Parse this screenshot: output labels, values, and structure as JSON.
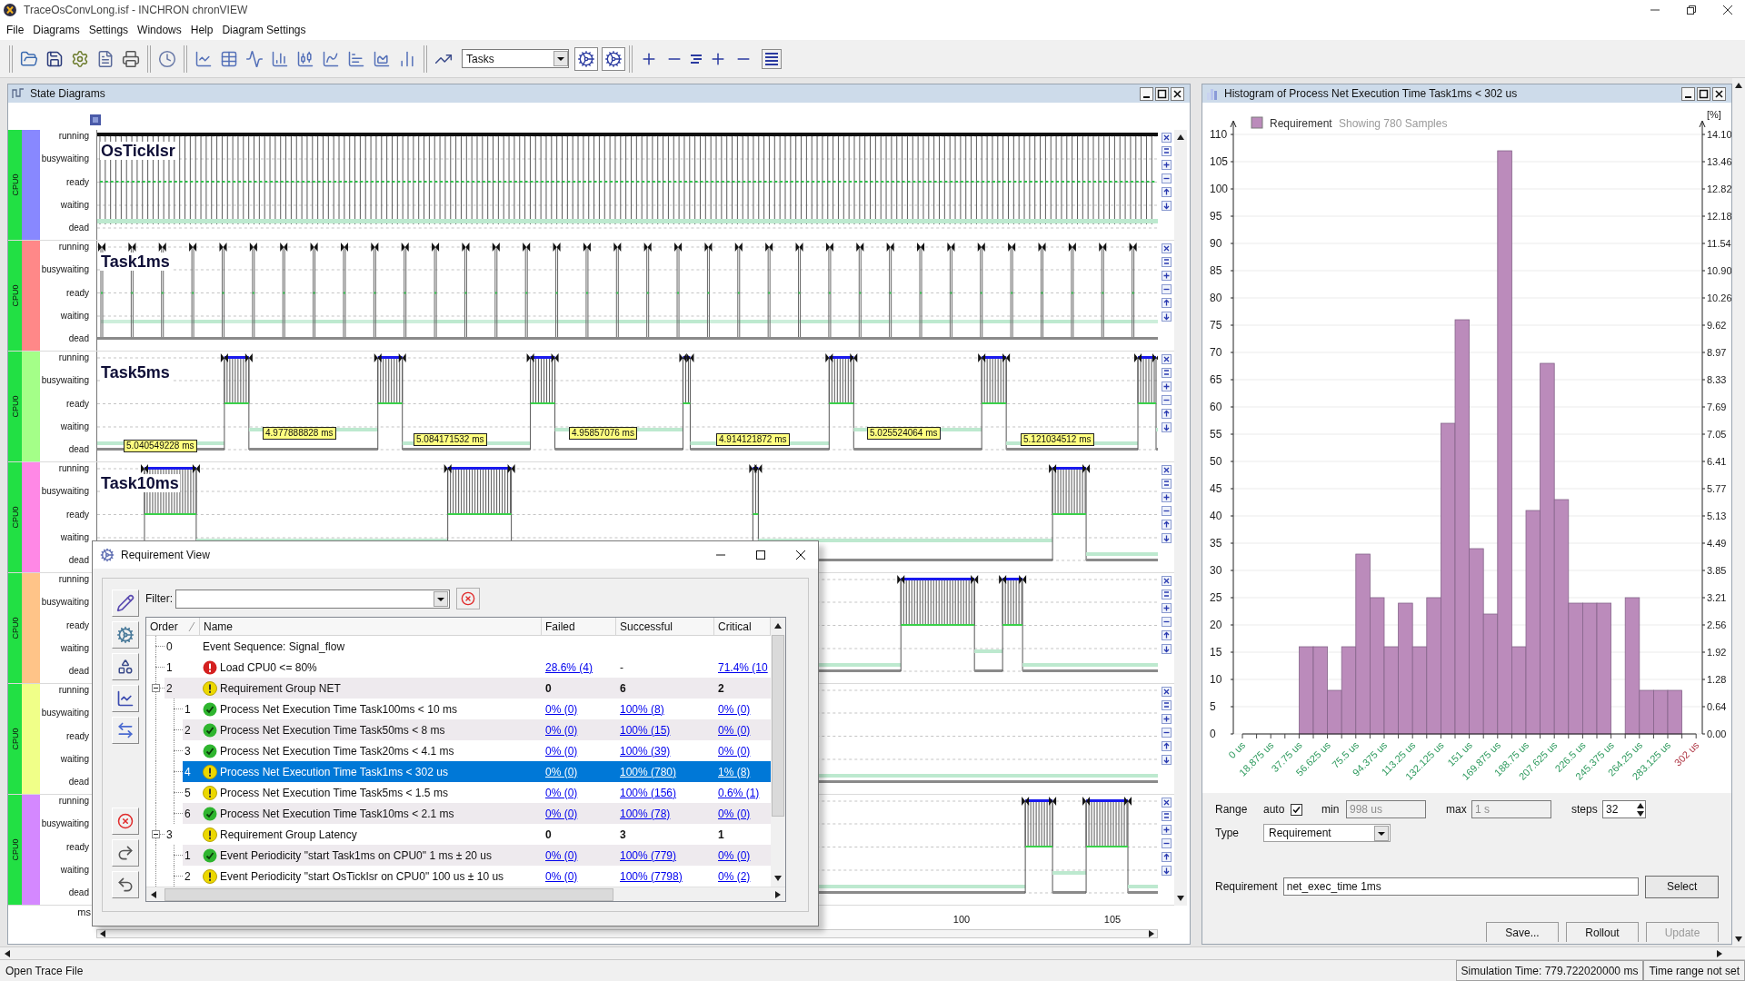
{
  "window": {
    "title": "TraceOsConvLong.isf - INCHRON chronVIEW"
  },
  "menu": [
    "File",
    "Diagrams",
    "Settings",
    "Windows",
    "Help",
    "Diagram Settings"
  ],
  "toolbar": {
    "view_select": "Tasks"
  },
  "state_diagrams": {
    "title": "State Diagrams",
    "lanes": [
      {
        "cpu": "CPU0",
        "color": "#8888ff",
        "task": "OsTickIsr",
        "states": [
          "running",
          "busywaiting",
          "ready",
          "waiting",
          "dead"
        ]
      },
      {
        "cpu": "CPU0",
        "color": "#ff8888",
        "task": "Task1ms",
        "states": [
          "running",
          "busywaiting",
          "ready",
          "waiting",
          "dead"
        ]
      },
      {
        "cpu": "CPU0",
        "color": "#a4ff88",
        "task": "Task5ms",
        "states": [
          "running",
          "busywaiting",
          "ready",
          "waiting",
          "dead"
        ],
        "durations": [
          "5.040549228 ms",
          "4.977888828 ms",
          "5.084171532 ms",
          "4.95857076 ms",
          "4.914121872 ms",
          "5.025524064 ms",
          "5.121034512 ms"
        ]
      },
      {
        "cpu": "CPU0",
        "color": "#ff88e6",
        "task": "Task10ms",
        "states": [
          "running",
          "busywaiting",
          "ready",
          "waiting",
          "dead"
        ]
      },
      {
        "cpu": "CPU0",
        "color": "#ffc488",
        "states": [
          "running",
          "busywaiting",
          "ready",
          "waiting",
          "dead"
        ]
      },
      {
        "cpu": "CPU0",
        "color": "#f0ff88",
        "states": [
          "running",
          "busywaiting",
          "ready",
          "waiting",
          "dead"
        ]
      },
      {
        "cpu": "CPU0",
        "color": "#d488ff",
        "states": [
          "running",
          "busywaiting",
          "ready",
          "waiting",
          "dead"
        ]
      }
    ],
    "axis": {
      "unit": "ms",
      "ticks": [
        "100",
        "105"
      ]
    }
  },
  "requirement_view": {
    "title": "Requirement View",
    "filter_label": "Filter:",
    "columns": [
      {
        "label": "Order",
        "sorted": true
      },
      {
        "label": "Name",
        "sorted": false
      },
      {
        "label": "Failed",
        "sorted": false
      },
      {
        "label": "Successful",
        "sorted": false
      },
      {
        "label": "Critical",
        "sorted": false
      }
    ],
    "rows": [
      {
        "order": "0",
        "name": "Event Sequence: Signal_flow",
        "selected": false
      },
      {
        "order": "1",
        "name": "Load CPU0 <= 80%",
        "kind": "error",
        "selected": false,
        "failed": {
          "text": "28.6% (4)",
          "link": true
        },
        "successful": {
          "text": "-",
          "link": false
        },
        "critical": {
          "text": "71.4% (10",
          "link": true
        }
      },
      {
        "order": "2",
        "name": "Requirement Group NET",
        "kind": "warning",
        "selected": false,
        "expanded": true,
        "failed": {
          "text": "0",
          "link": false
        },
        "successful": {
          "text": "6",
          "link": false
        },
        "critical": {
          "text": "2",
          "link": false
        },
        "children": [
          {
            "order": "1",
            "name": "Process Net Execution Time Task100ms < 10 ms",
            "kind": "ok",
            "selected": false,
            "failed": {
              "text": "0% (0)",
              "link": true
            },
            "successful": {
              "text": "100% (8)",
              "link": true
            },
            "critical": {
              "text": "0% (0)",
              "link": true
            }
          },
          {
            "order": "2",
            "name": "Process Net Execution Time Task50ms < 8 ms",
            "kind": "ok",
            "selected": false,
            "failed": {
              "text": "0% (0)",
              "link": true
            },
            "successful": {
              "text": "100% (15)",
              "link": true
            },
            "critical": {
              "text": "0% (0)",
              "link": true
            }
          },
          {
            "order": "3",
            "name": "Process Net Execution Time Task20ms < 4.1 ms",
            "kind": "ok",
            "selected": false,
            "failed": {
              "text": "0% (0)",
              "link": true
            },
            "successful": {
              "text": "100% (39)",
              "link": true
            },
            "critical": {
              "text": "0% (0)",
              "link": true
            }
          },
          {
            "order": "4",
            "name": "Process Net Execution Time Task1ms < 302 us",
            "kind": "warning",
            "selected": true,
            "failed": {
              "text": "0% (0)",
              "link": true
            },
            "successful": {
              "text": "100% (780)",
              "link": true
            },
            "critical": {
              "text": "1% (8)",
              "link": true
            }
          },
          {
            "order": "5",
            "name": "Process Net Execution Time Task5ms < 1.5 ms",
            "kind": "warning",
            "selected": false,
            "failed": {
              "text": "0% (0)",
              "link": true
            },
            "successful": {
              "text": "100% (156)",
              "link": true
            },
            "critical": {
              "text": "0.6% (1)",
              "link": true
            }
          },
          {
            "order": "6",
            "name": "Process Net Execution Time Task10ms < 2.1 ms",
            "kind": "ok",
            "selected": false,
            "failed": {
              "text": "0% (0)",
              "link": true
            },
            "successful": {
              "text": "100% (78)",
              "link": true
            },
            "critical": {
              "text": "0% (0)",
              "link": true
            }
          }
        ]
      },
      {
        "order": "3",
        "name": "Requirement Group Latency",
        "kind": "warning",
        "selected": false,
        "expanded": true,
        "failed": {
          "text": "0",
          "link": false
        },
        "successful": {
          "text": "3",
          "link": false
        },
        "critical": {
          "text": "1",
          "link": false
        },
        "children": [
          {
            "order": "1",
            "name": "Event Periodicity \"start Task1ms on CPU0\" 1 ms ± 20 us",
            "kind": "ok",
            "selected": false,
            "failed": {
              "text": "0% (0)",
              "link": true
            },
            "successful": {
              "text": "100% (779)",
              "link": true
            },
            "critical": {
              "text": "0% (0)",
              "link": true
            }
          },
          {
            "order": "2",
            "name": "Event Periodicity \"start OsTickIsr on CPU0\" 100 us ± 10 us",
            "kind": "warning",
            "selected": false,
            "failed": {
              "text": "0% (0)",
              "link": true
            },
            "successful": {
              "text": "100% (7798)",
              "link": true
            },
            "critical": {
              "text": "0% (2)",
              "link": true
            }
          }
        ]
      }
    ]
  },
  "histogram": {
    "title": "Histogram of Process Net Execution Time Task1ms < 302 us",
    "sample_note": "Showing 780 Samples",
    "right_axis": {
      "unit": "[%]",
      "ticks": [
        "14.10",
        "13.46",
        "12.82",
        "12.18",
        "11.54",
        "10.90",
        "10.26",
        "9.62",
        "8.97",
        "8.33",
        "7.69",
        "7.05",
        "6.41",
        "5.77",
        "5.13",
        "4.49",
        "3.85",
        "3.21",
        "2.56",
        "1.92",
        "1.28",
        "0.64",
        "0.00"
      ]
    },
    "chart_data": {
      "type": "bar",
      "xlim": [
        0,
        302
      ],
      "ylim": [
        0,
        110
      ],
      "grid": true,
      "x": [
        4.71875,
        14.15625,
        23.59375,
        33.03125,
        42.46875,
        51.90625,
        61.34375,
        70.78125,
        80.21875,
        89.65625,
        99.09375,
        108.53125,
        117.96875,
        127.40625,
        136.84375,
        146.28125,
        155.71875,
        165.15625,
        174.59375,
        184.03125,
        193.46875,
        202.90625,
        212.34375,
        221.78125,
        231.21875,
        240.65625,
        250.09375,
        259.53125,
        268.96875,
        278.40625,
        287.84375,
        297.28125
      ],
      "series": [
        {
          "name": "Requirement",
          "color": "#bb8bbb",
          "values": [
            0,
            0,
            0,
            0,
            16,
            16,
            8,
            16,
            33,
            25,
            16,
            24,
            16,
            25,
            57,
            76,
            34,
            22,
            107,
            16,
            41,
            68,
            43,
            24,
            24,
            24,
            0,
            25,
            8,
            8,
            8,
            0
          ]
        }
      ],
      "xticks": [
        {
          "value": 0,
          "label": "0 us"
        },
        {
          "value": 18.875,
          "label": "18.875 us"
        },
        {
          "value": 37.75,
          "label": "37.75 us"
        },
        {
          "value": 56.625,
          "label": "56.625 us"
        },
        {
          "value": 75.5,
          "label": "75.5 us"
        },
        {
          "value": 94.375,
          "label": "94.375 us"
        },
        {
          "value": 113.25,
          "label": "113.25 us"
        },
        {
          "value": 132.125,
          "label": "132.125 us"
        },
        {
          "value": 151,
          "label": "151 us"
        },
        {
          "value": 169.875,
          "label": "169.875 us"
        },
        {
          "value": 188.75,
          "label": "188.75 us"
        },
        {
          "value": 207.625,
          "label": "207.625 us"
        },
        {
          "value": 226.5,
          "label": "226.5 us"
        },
        {
          "value": 245.375,
          "label": "245.375 us"
        },
        {
          "value": 264.25,
          "label": "264.25 us"
        },
        {
          "value": 283.125,
          "label": "283.125 us"
        }
      ],
      "annotations": [
        "302 us"
      ],
      "yticks": [
        0,
        5,
        10,
        15,
        20,
        25,
        30,
        35,
        40,
        45,
        50,
        55,
        60,
        65,
        70,
        75,
        80,
        85,
        90,
        95,
        100,
        105,
        110
      ]
    },
    "controls": {
      "range": {
        "label": "Range",
        "auto_label": "auto",
        "auto": true,
        "min_label": "min",
        "min": "998 us",
        "max_label": "max",
        "max": "1 s",
        "steps_label": "steps",
        "steps": "32"
      },
      "type": {
        "label": "Type",
        "value": "Requirement"
      },
      "requirement": {
        "label": "Requirement",
        "value": "net_exec_time 1ms",
        "button": "Select"
      },
      "buttons": [
        {
          "label": "Save...",
          "disabled": false
        },
        {
          "label": "Rollout",
          "disabled": false
        },
        {
          "label": "Update",
          "disabled": true
        }
      ]
    }
  },
  "status_bar": {
    "message": "Open Trace File",
    "simulation_time": "Simulation Time: 779.722020000 ms",
    "time_range": "Time range not set"
  }
}
